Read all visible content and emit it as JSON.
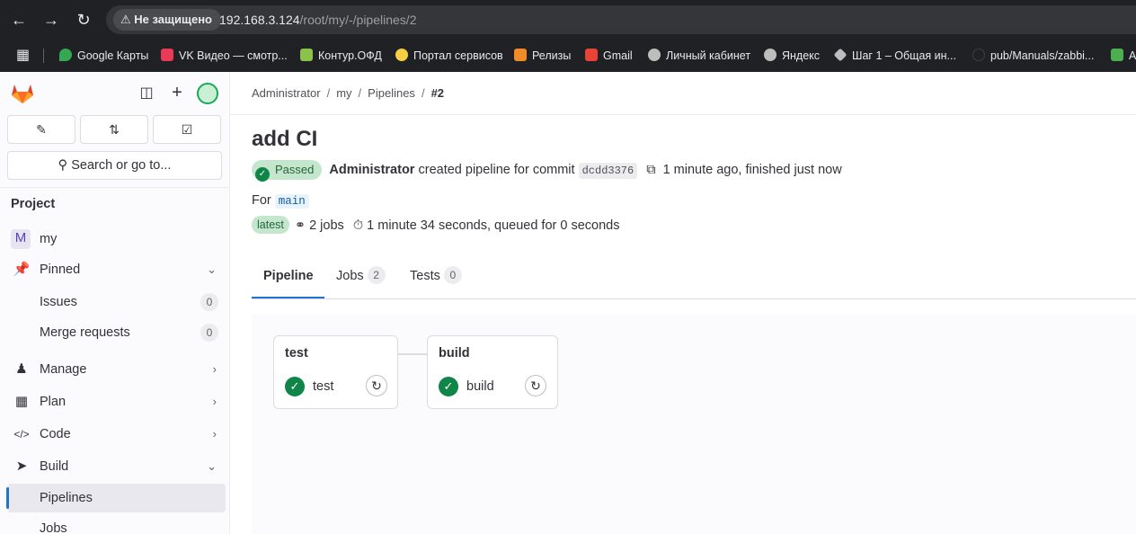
{
  "browser": {
    "security_label": "Не защищено",
    "url_host": "192.168.3.124",
    "url_path": "/root/my/-/pipelines/2",
    "bookmarks": [
      {
        "label": "Google Карты",
        "color": "#34a853"
      },
      {
        "label": "VK Видео — смотр...",
        "color": "#ea3a55"
      },
      {
        "label": "Контур.ОФД",
        "color": "#8bc34a"
      },
      {
        "label": "Портал сервисов",
        "color": "#f5d142"
      },
      {
        "label": "Релизы",
        "color": "#f28c28"
      },
      {
        "label": "Gmail",
        "color": "#ea4335"
      },
      {
        "label": "Личный кабинет",
        "color": "#bdbdbd"
      },
      {
        "label": "Яндекс",
        "color": "#bdbdbd"
      },
      {
        "label": "Шаг 1 – Общая ин...",
        "color": "#bdbdbd"
      },
      {
        "label": "pub/Manuals/zabbi...",
        "color": "#202124"
      },
      {
        "label": "A",
        "color": "#4caf50"
      }
    ]
  },
  "sidebar": {
    "search_label": "Search or go to...",
    "section_label": "Project",
    "project": {
      "avatar_letter": "M",
      "name": "my"
    },
    "items": [
      {
        "label": "Pinned",
        "icon": "pin-icon"
      },
      {
        "label": "Issues",
        "count": "0"
      },
      {
        "label": "Merge requests",
        "count": "0"
      },
      {
        "label": "Manage",
        "icon": "users-icon"
      },
      {
        "label": "Plan",
        "icon": "calendar-icon"
      },
      {
        "label": "Code",
        "icon": "code-icon"
      },
      {
        "label": "Build",
        "icon": "rocket-icon"
      },
      {
        "label": "Pipelines"
      },
      {
        "label": "Jobs"
      }
    ]
  },
  "breadcrumb": [
    "Administrator",
    "my",
    "Pipelines",
    "#2"
  ],
  "pipeline": {
    "title": "add CI",
    "status": "Passed",
    "author": "Administrator",
    "action_text": "created pipeline for commit",
    "commit": "dcdd3376",
    "time_text": "1 minute ago, finished just now",
    "for_label": "For",
    "branch": "main",
    "latest_badge": "latest",
    "jobs_text": "2 jobs",
    "duration_text": "1 minute 34 seconds, queued for 0 seconds"
  },
  "tabs": [
    {
      "label": "Pipeline"
    },
    {
      "label": "Jobs",
      "count": "2"
    },
    {
      "label": "Tests",
      "count": "0"
    }
  ],
  "stages": [
    {
      "name": "test",
      "job": "test"
    },
    {
      "name": "build",
      "job": "build"
    }
  ],
  "colors": {
    "success": "#108548",
    "accent": "#1f75cb",
    "gitlab_orange": "#e24329"
  }
}
